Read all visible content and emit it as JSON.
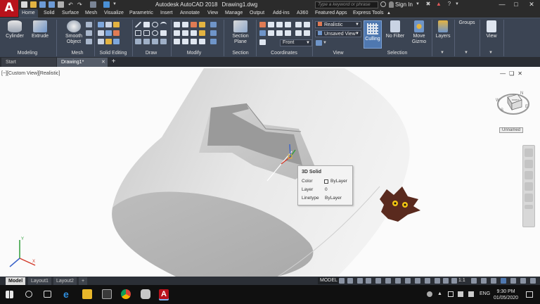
{
  "window": {
    "app_name": "Autodesk AutoCAD 2018",
    "file_name": "Drawing1.dwg",
    "app_logo": "A",
    "search_placeholder": "Type a keyword or phrase",
    "sign_in": "Sign In"
  },
  "ribbon_tabs": [
    "Home",
    "Solid",
    "Surface",
    "Mesh",
    "Visualize",
    "Parametric",
    "Insert",
    "Annotate",
    "View",
    "Manage",
    "Output",
    "Add-ins",
    "A360",
    "Featured Apps",
    "Express Tools"
  ],
  "active_ribbon_tab": "Home",
  "ribbon": {
    "cylinder": "Cylinder",
    "extrude": "Extrude",
    "smooth_object_1": "Smooth",
    "smooth_object_2": "Object",
    "section_plane_1": "Section",
    "section_plane_2": "Plane",
    "visual_style": "Realistic",
    "named_view": "Unsaved View",
    "view_direction": "Front",
    "culling": "Culling",
    "no_filter": "No Filter",
    "move_gizmo_1": "Move",
    "move_gizmo_2": "Gizmo",
    "layers": "Layers",
    "groups": "Groups",
    "view": "View",
    "groups_labels": {
      "modeling": "Modeling",
      "mesh": "Mesh",
      "solid_editing": "Solid Editing",
      "draw": "Draw",
      "modify": "Modify",
      "section": "Section",
      "coordinates": "Coordinates",
      "view": "View",
      "selection": "Selection"
    }
  },
  "file_tabs": {
    "start": "Start",
    "drawing": "Drawing1*"
  },
  "viewport": {
    "view_label": "[−][Custom View][Realistic]",
    "viewcube_label": "Unnamed",
    "compass": {
      "n": "N",
      "s": "S",
      "w": "W",
      "e": "E"
    },
    "viewcube_face": "FRONT"
  },
  "tooltip": {
    "title": "3D Solid",
    "rows": [
      {
        "key": "Color",
        "value": "ByLayer"
      },
      {
        "key": "Layer",
        "value": "0"
      },
      {
        "key": "Linetype",
        "value": "ByLayer"
      }
    ]
  },
  "layout_tabs": [
    "Model",
    "Layout1",
    "Layout2"
  ],
  "status": {
    "model": "MODEL",
    "scale": "1:1"
  },
  "taskbar": {
    "language": "ENG",
    "time": "9:30 PM",
    "date": "01/05/2020"
  },
  "colors": {
    "accent_red": "#b8121b",
    "ribbon_bg": "#3b4453",
    "culling_active": "#4f78b0",
    "viewport_bg": "#fbfbfb"
  }
}
